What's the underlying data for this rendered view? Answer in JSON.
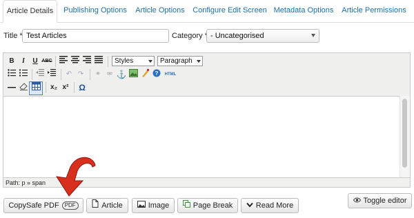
{
  "tabs": [
    "Article Details",
    "Publishing Options",
    "Article Options",
    "Configure Edit Screen",
    "Metadata Options",
    "Article Permissions"
  ],
  "form": {
    "title_label": "Title *",
    "title_value": "Test Articles",
    "category_label": "Category *",
    "category_value": "- Uncategorised"
  },
  "toolbar": {
    "bold": "B",
    "italic": "I",
    "underline": "U",
    "strike": "ABC",
    "styles": "Styles",
    "paragraph": "Paragraph",
    "html": "HTML",
    "sub": "x₂",
    "sup": "x²",
    "omega": "Ω"
  },
  "editor": {
    "path": "Path: p » span"
  },
  "buttons": {
    "copysafe": "CopySafe PDF",
    "copysafe_badge": "PDF",
    "article": "Article",
    "image": "Image",
    "page_break": "Page Break",
    "read_more": "Read More",
    "toggle": "Toggle editor"
  },
  "colors": {
    "link": "#1e6ea8",
    "arrow": "#d9301e"
  }
}
